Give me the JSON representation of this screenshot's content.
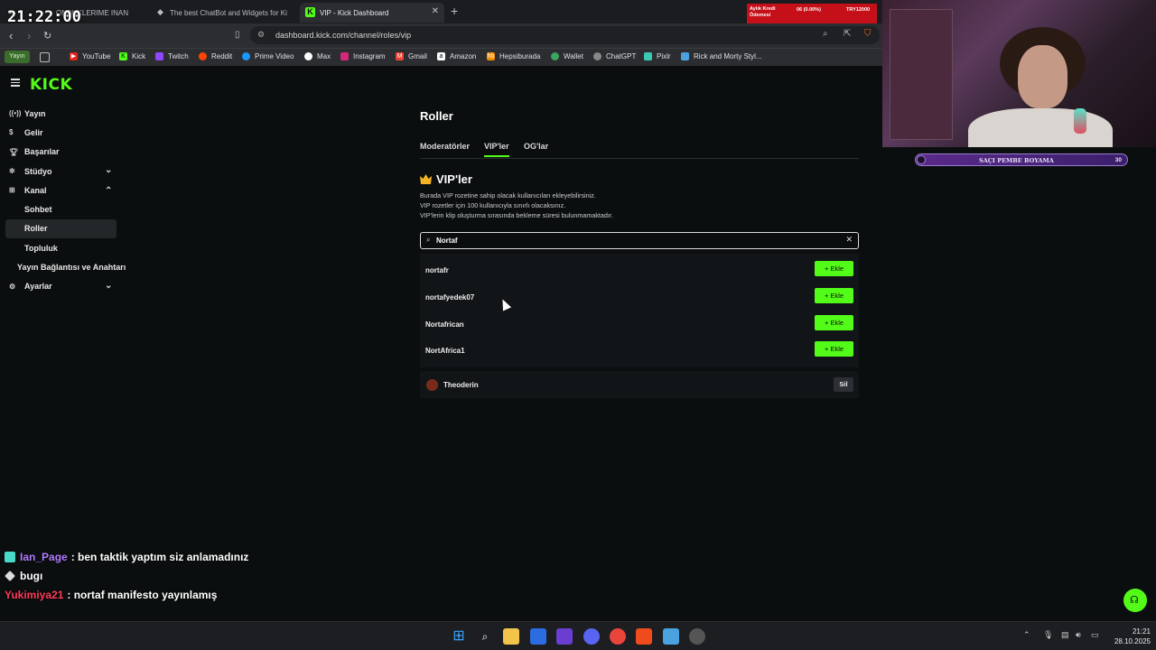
{
  "clock_overlay": "21:22:00",
  "browser": {
    "tabs": [
      {
        "label": "ONDUKLERIME INAN",
        "active": false
      },
      {
        "label": "The best ChatBot and Widgets for Ki",
        "active": false
      },
      {
        "label": "VIP - Kick Dashboard",
        "active": true
      }
    ],
    "new_tab": "+",
    "url": "dashboard.kick.com/channel/roles/vip",
    "bookmarks": [
      "YouTube",
      "Kick",
      "Twitch",
      "Reddit",
      "Prime Video",
      "Max",
      "Instagram",
      "Gmail",
      "Amazon",
      "Hepsiburada",
      "Wallet",
      "ChatGPT",
      "Pixlr",
      "Rick and Morty Styl..."
    ],
    "bookmark_pill": "Yayın",
    "stocks": {
      "label": "Aylık Kredi Ödemesi",
      "change": "06 (0.00%)",
      "currency": "TRY12000"
    }
  },
  "sidebar": {
    "items": [
      {
        "label": "Yayın",
        "icon": "broadcast-icon"
      },
      {
        "label": "Gelir",
        "icon": "dollar-icon"
      },
      {
        "label": "Başarılar",
        "icon": "trophy-icon"
      },
      {
        "label": "Stüdyo",
        "icon": "studio-icon"
      },
      {
        "label": "Kanal",
        "icon": "channel-icon"
      },
      {
        "label": "Sohbet"
      },
      {
        "label": "Roller"
      },
      {
        "label": "Topluluk"
      },
      {
        "label": "Yayın Bağlantısı ve Anahtarı"
      },
      {
        "label": "Ayarlar",
        "icon": "gear-icon"
      }
    ]
  },
  "main": {
    "title": "Roller",
    "tabs": [
      "Moderatörler",
      "VIP'ler",
      "OG'lar"
    ],
    "section_title": "VIP'ler",
    "description": [
      "Burada VIP rozetine sahip olacak kullanıcıları ekleyebilirsiniz.",
      "VIP rozetler için 100 kullanıcıyla sınırlı olacaksınız.",
      "VIP'lerin klip oluşturma sırasında bekleme süresi bulunmamaktadır."
    ],
    "search_value": "Nortaf",
    "results": [
      {
        "name": "nortafr",
        "action": "Ekle"
      },
      {
        "name": "nortafyedek07",
        "action": "Ekle"
      },
      {
        "name": "Nortafrican",
        "action": "Ekle"
      },
      {
        "name": "NortAfrica1",
        "action": "Ekle"
      }
    ],
    "vips": [
      {
        "name": "Theoderin",
        "action": "Sil"
      }
    ]
  },
  "overlay": {
    "goal_text": "SAÇI PEMBE BOYAMA",
    "goal_count": "30"
  },
  "chat": [
    {
      "user": "Ian_Page",
      "user_color": "#b07cff",
      "message": ": ben taktik yaptım siz anlamadınız"
    },
    {
      "user": "",
      "user_color": "#ffffff",
      "message": "bugı"
    },
    {
      "user": "Yukimiya21",
      "user_color": "#ff3a5a",
      "message": ": nortaf manifesto yayınlamış"
    }
  ],
  "taskbar": {
    "time": "21:21",
    "date": "28.10.2025"
  },
  "colors": {
    "accent": "#53fc18",
    "background": "#0b0e0f"
  }
}
